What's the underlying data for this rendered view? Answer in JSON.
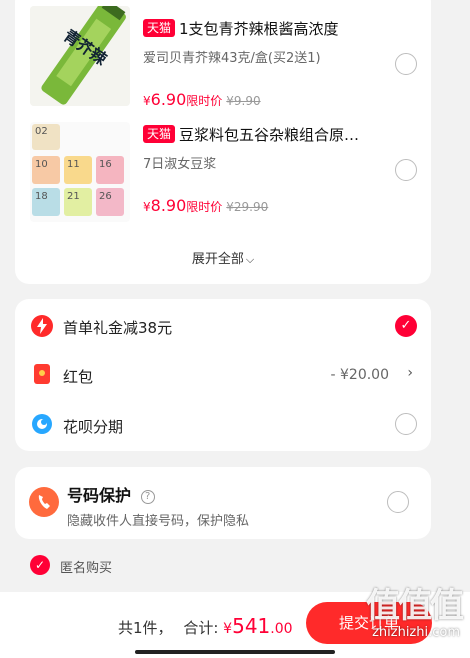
{
  "products": [
    {
      "tag": "天猫",
      "title": "1支包青芥辣根酱高浓度",
      "subtitle": "爱司贝青芥辣43克/盒(买2送1)",
      "currency": "¥",
      "price": "6.90",
      "price_label": "限时价",
      "old_price": "¥9.90",
      "thumb_text": "青芥辣"
    },
    {
      "tag": "天猫",
      "title": "豆浆料包五谷杂粮组合原…",
      "subtitle": "7日淑女豆浆",
      "currency": "¥",
      "price": "8.90",
      "price_label": "限时价",
      "old_price": "¥29.90",
      "thumb_numbers": [
        "02",
        "10",
        "11",
        "16",
        "18",
        "21",
        "26"
      ]
    }
  ],
  "expand_label": "展开全部",
  "benefits": {
    "first_order": "首单礼金减38元",
    "red_packet": "红包",
    "red_packet_value": "- ¥20.00",
    "huabei": "花呗分期"
  },
  "phone_protect": {
    "title": "号码保护",
    "desc": "隐藏收件人直接号码，保护隐私"
  },
  "anonymous": "匿名购买",
  "footer": {
    "count": "共1件，",
    "total_label": "合计:",
    "currency": "¥",
    "total_int": "541",
    "total_dec": ".00",
    "submit": "提交订单"
  },
  "watermark": {
    "logo": "值值值",
    "url": "zhizhizhi.com"
  },
  "colors": {
    "accent": "#ff0036",
    "submit": "#ff2a2a",
    "background": "#f2f2f2"
  }
}
